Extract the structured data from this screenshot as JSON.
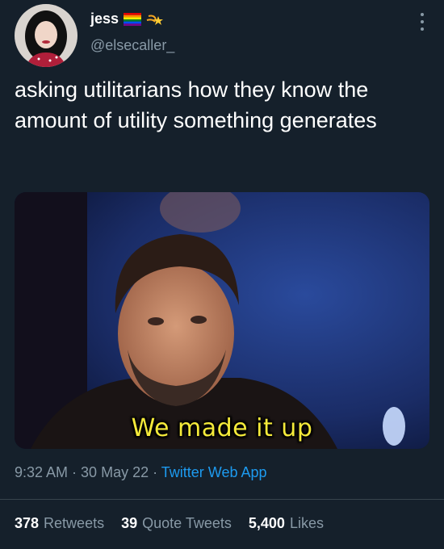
{
  "user": {
    "display_name": "jess",
    "handle": "@elsecaller_"
  },
  "tweet": {
    "text": "asking utilitarians how they know the amount of utility something generates"
  },
  "media": {
    "caption": "We made it up"
  },
  "meta": {
    "time": "9:32 AM",
    "separator1": " · ",
    "date": "30 May 22",
    "separator2": " · ",
    "source": "Twitter Web App"
  },
  "stats": {
    "retweets_count": "378",
    "retweets_label": "Retweets",
    "quotes_count": "39",
    "quotes_label": "Quote Tweets",
    "likes_count": "5,400",
    "likes_label": "Likes"
  },
  "colors": {
    "background": "#15202b",
    "secondary_text": "#8899a6",
    "link": "#1d9bf0",
    "caption": "#f4ea3a"
  },
  "icons": [
    "avatar",
    "rainbow-flag-icon",
    "shooting-star-icon",
    "more-options-icon"
  ]
}
